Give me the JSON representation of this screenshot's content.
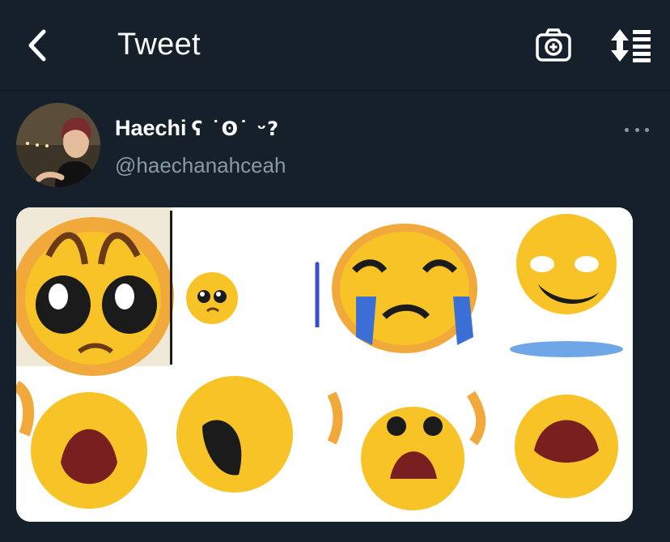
{
  "nav": {
    "title": "Tweet",
    "back_icon": "chevron-left-icon",
    "camera_icon": "camera-add-icon",
    "sort_icon": "sort-list-icon"
  },
  "tweet": {
    "display_name": "Haechi",
    "name_kaomoji": "ʕ ˙ʘ˙ ᵕ?",
    "handle": "@haechanahceah",
    "more_icon": "more-dots-icon",
    "media_description_icon": "crying-emoji-collage-image"
  },
  "colors": {
    "background": "#15202b",
    "text_primary": "#ffffff",
    "text_secondary": "#8899a6",
    "emoji_yellow": "#f7c327",
    "tear_blue": "#3b6fd6"
  }
}
